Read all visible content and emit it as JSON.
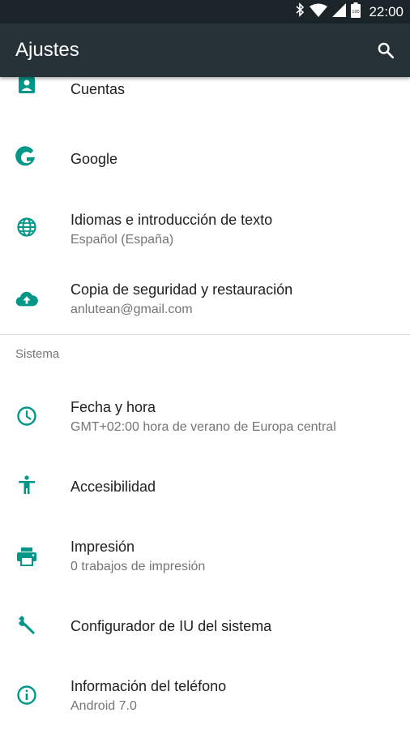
{
  "status_bar": {
    "time": "22:00",
    "battery_level": "100",
    "icons": [
      "bluetooth-icon",
      "wifi-icon",
      "signal-icon",
      "battery-icon"
    ]
  },
  "app_bar": {
    "title": "Ajustes",
    "search_icon": "search-icon"
  },
  "colors": {
    "status_bar": "#1b2429",
    "app_bar": "#263238",
    "accent": "#009688",
    "title_text": "#212121",
    "summary_text": "#757575"
  },
  "settings": {
    "items": [
      {
        "icon": "account-icon",
        "title": "Cuentas"
      },
      {
        "icon": "google-icon",
        "title": "Google"
      },
      {
        "icon": "globe-icon",
        "title": "Idiomas e introducción de texto",
        "summary": "Español (España)"
      },
      {
        "icon": "cloud-upload-icon",
        "title": "Copia de seguridad y restauración",
        "summary": "anlutean@gmail.com"
      }
    ],
    "section_sistema": "Sistema",
    "sistema_items": [
      {
        "icon": "clock-icon",
        "title": "Fecha y hora",
        "summary": "GMT+02:00 hora de verano de Europa central"
      },
      {
        "icon": "accessibility-icon",
        "title": "Accesibilidad"
      },
      {
        "icon": "printer-icon",
        "title": "Impresión",
        "summary": "0 trabajos de impresión"
      },
      {
        "icon": "wrench-icon",
        "title": "Configurador de IU del sistema"
      },
      {
        "icon": "info-icon",
        "title": "Información del teléfono",
        "summary": "Android 7.0"
      }
    ]
  }
}
